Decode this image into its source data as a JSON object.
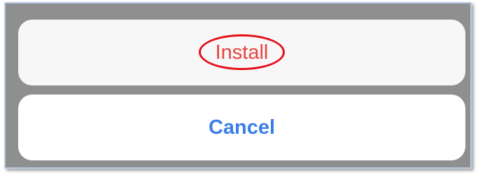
{
  "action_sheet": {
    "install_label": "Install",
    "cancel_label": "Cancel"
  },
  "colors": {
    "install_text": "#e8453f",
    "cancel_text": "#3a7ee8",
    "highlight_ring": "#e3101a",
    "backdrop": "#8f8f8f"
  }
}
